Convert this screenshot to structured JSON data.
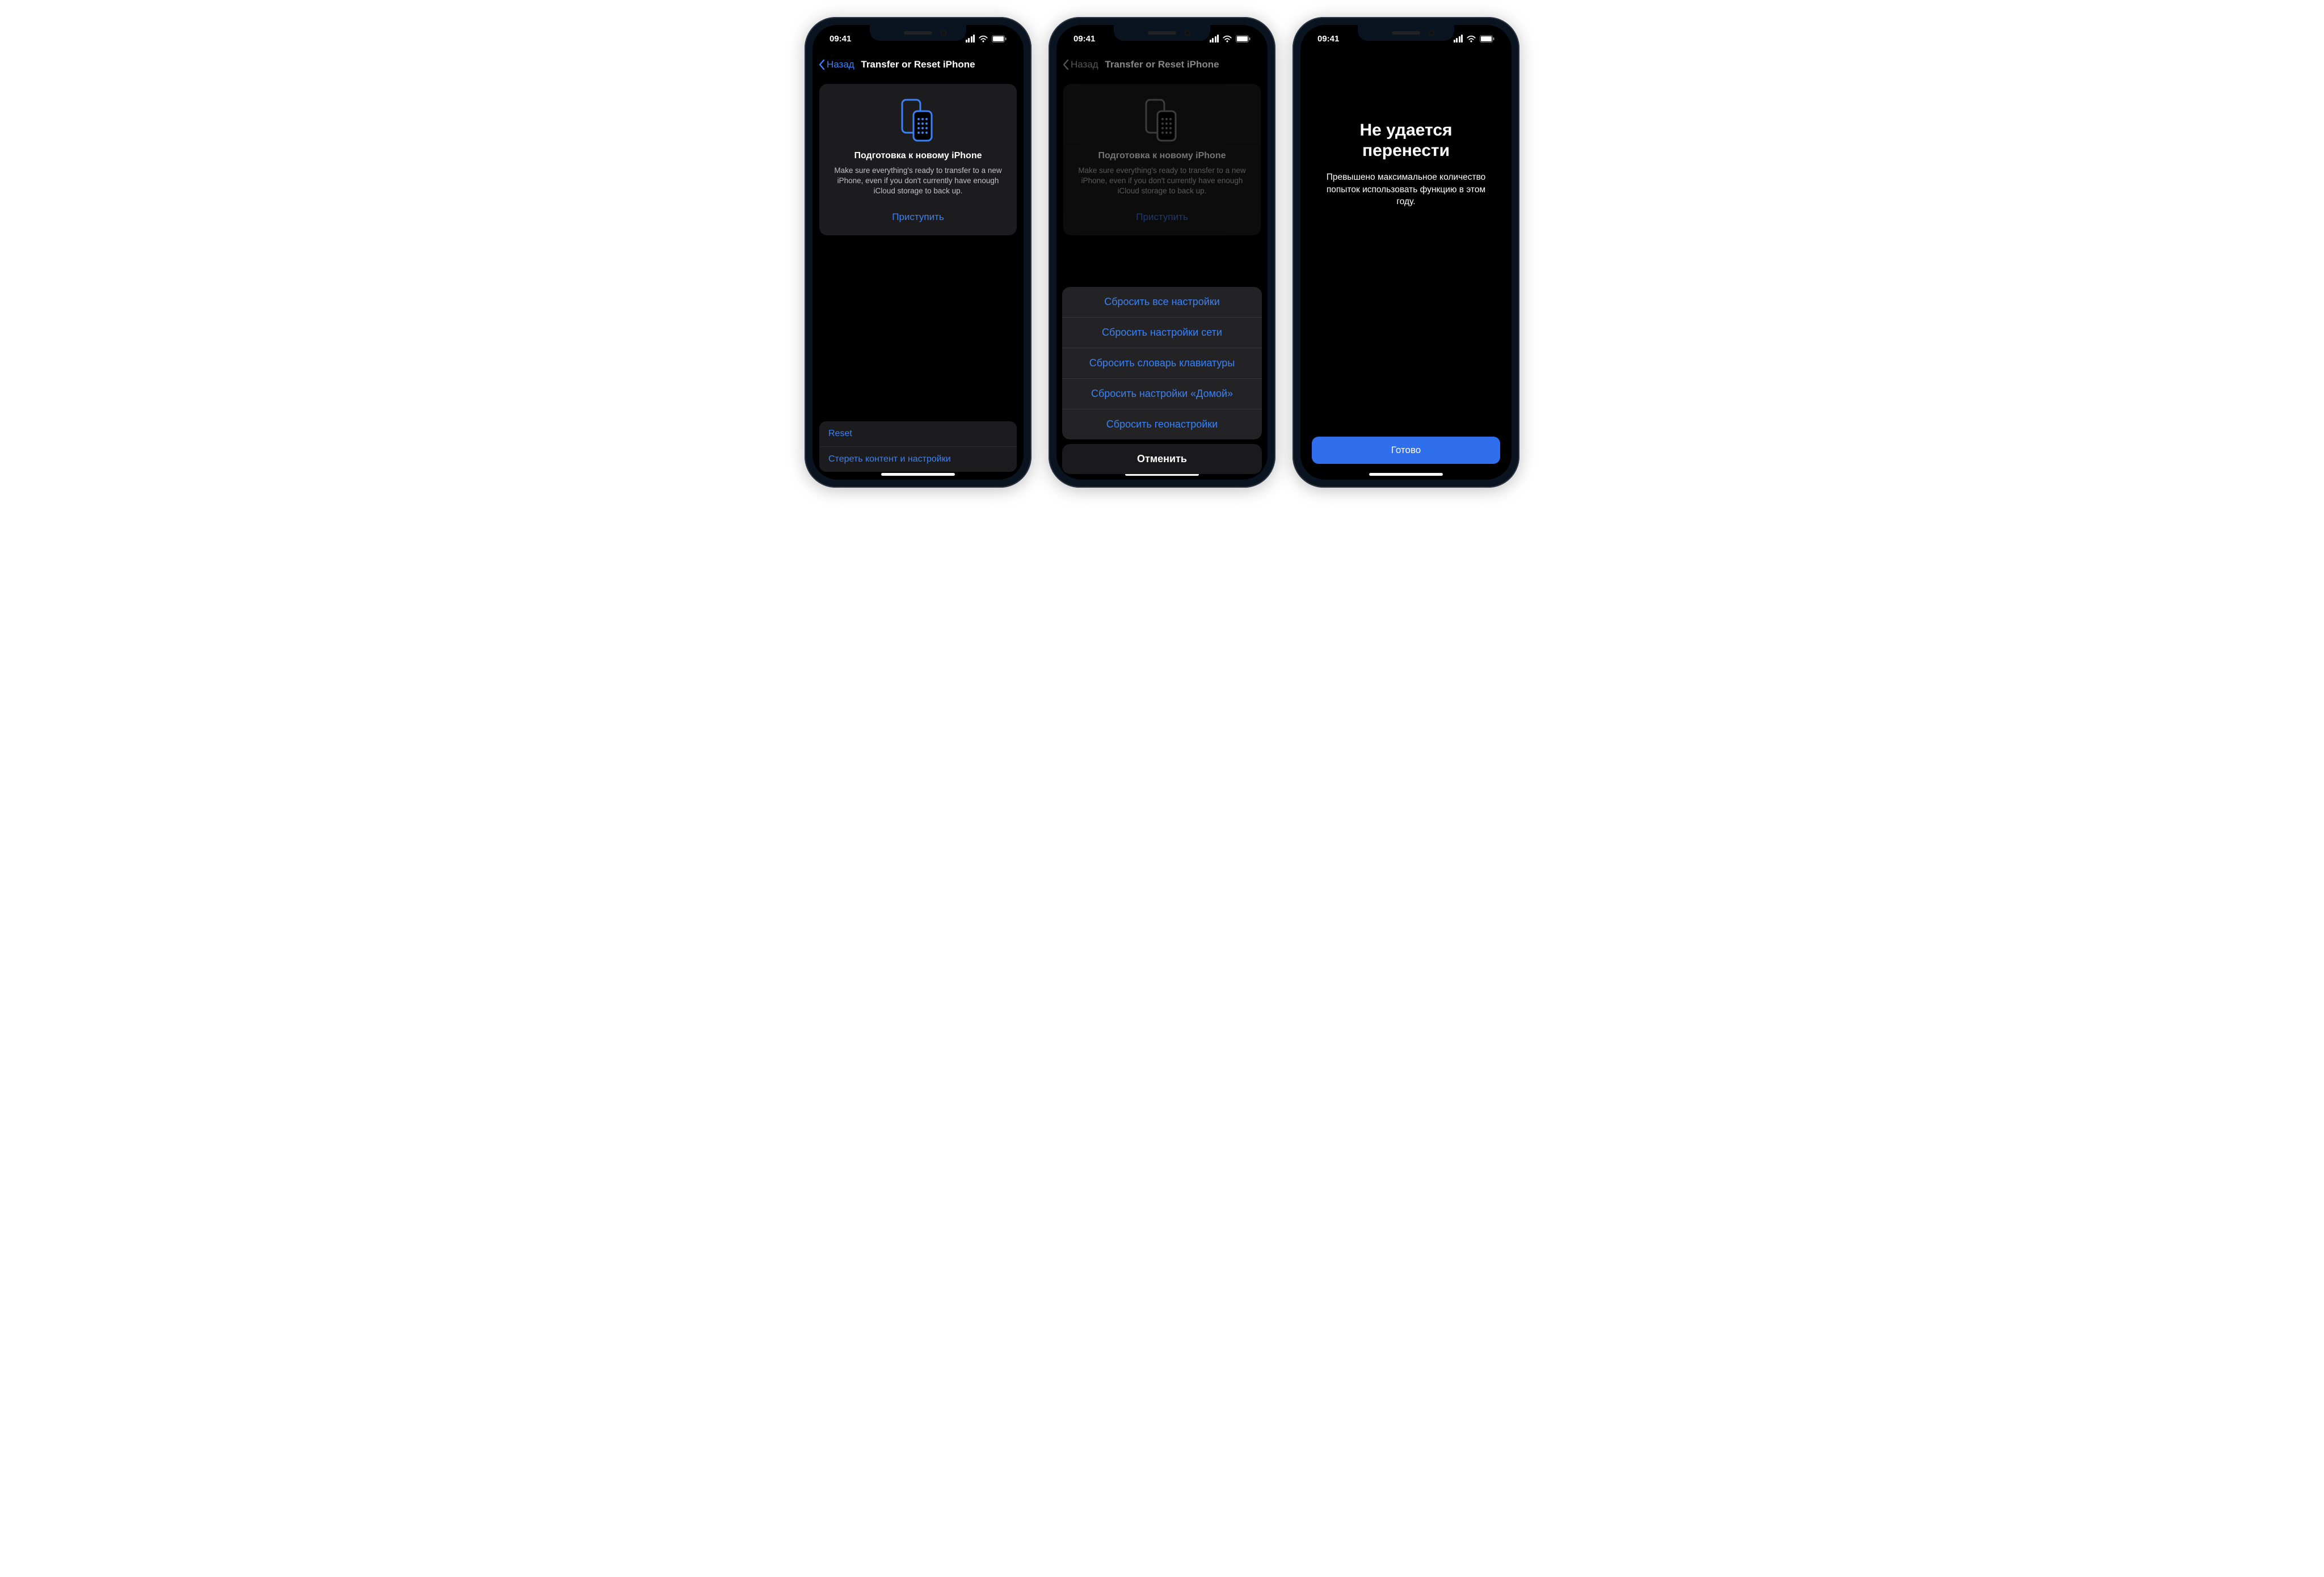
{
  "statusbar": {
    "time": "09:41"
  },
  "nav": {
    "back_label": "Назад",
    "title": "Transfer or Reset iPhone"
  },
  "prepare_card": {
    "heading": "Подготовка к новому iPhone",
    "body": "Make sure everything's ready to transfer to a new iPhone, even if you don't currently have enough iCloud storage to back up.",
    "start_label": "Приступить"
  },
  "bottom_rows": {
    "reset_label": "Reset",
    "erase_label": "Стереть контент и настройки"
  },
  "action_sheet": {
    "options": [
      "Сбросить все настройки",
      "Сбросить настройки сети",
      "Сбросить словарь клавиатуры",
      "Сбросить настройки «Домой»",
      "Сбросить геонастройки"
    ],
    "cancel_label": "Отменить"
  },
  "error": {
    "title": "Не удается перенести",
    "body": "Превышено максимальное количество попыток использовать функцию в этом году.",
    "done_label": "Готово"
  }
}
